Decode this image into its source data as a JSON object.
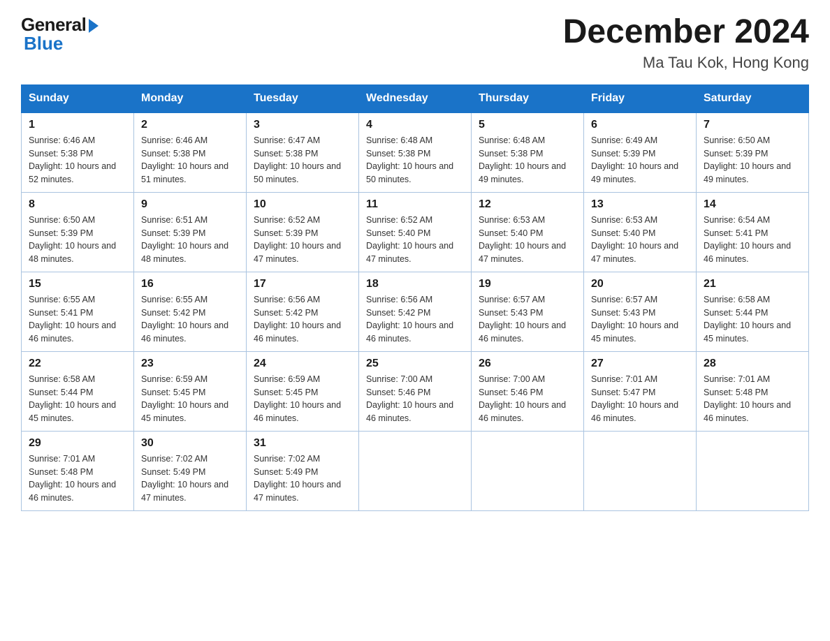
{
  "logo": {
    "general": "General",
    "blue": "Blue"
  },
  "title": "December 2024",
  "location": "Ma Tau Kok, Hong Kong",
  "headers": [
    "Sunday",
    "Monday",
    "Tuesday",
    "Wednesday",
    "Thursday",
    "Friday",
    "Saturday"
  ],
  "weeks": [
    [
      {
        "day": "1",
        "sunrise": "6:46 AM",
        "sunset": "5:38 PM",
        "daylight": "10 hours and 52 minutes."
      },
      {
        "day": "2",
        "sunrise": "6:46 AM",
        "sunset": "5:38 PM",
        "daylight": "10 hours and 51 minutes."
      },
      {
        "day": "3",
        "sunrise": "6:47 AM",
        "sunset": "5:38 PM",
        "daylight": "10 hours and 50 minutes."
      },
      {
        "day": "4",
        "sunrise": "6:48 AM",
        "sunset": "5:38 PM",
        "daylight": "10 hours and 50 minutes."
      },
      {
        "day": "5",
        "sunrise": "6:48 AM",
        "sunset": "5:38 PM",
        "daylight": "10 hours and 49 minutes."
      },
      {
        "day": "6",
        "sunrise": "6:49 AM",
        "sunset": "5:39 PM",
        "daylight": "10 hours and 49 minutes."
      },
      {
        "day": "7",
        "sunrise": "6:50 AM",
        "sunset": "5:39 PM",
        "daylight": "10 hours and 49 minutes."
      }
    ],
    [
      {
        "day": "8",
        "sunrise": "6:50 AM",
        "sunset": "5:39 PM",
        "daylight": "10 hours and 48 minutes."
      },
      {
        "day": "9",
        "sunrise": "6:51 AM",
        "sunset": "5:39 PM",
        "daylight": "10 hours and 48 minutes."
      },
      {
        "day": "10",
        "sunrise": "6:52 AM",
        "sunset": "5:39 PM",
        "daylight": "10 hours and 47 minutes."
      },
      {
        "day": "11",
        "sunrise": "6:52 AM",
        "sunset": "5:40 PM",
        "daylight": "10 hours and 47 minutes."
      },
      {
        "day": "12",
        "sunrise": "6:53 AM",
        "sunset": "5:40 PM",
        "daylight": "10 hours and 47 minutes."
      },
      {
        "day": "13",
        "sunrise": "6:53 AM",
        "sunset": "5:40 PM",
        "daylight": "10 hours and 47 minutes."
      },
      {
        "day": "14",
        "sunrise": "6:54 AM",
        "sunset": "5:41 PM",
        "daylight": "10 hours and 46 minutes."
      }
    ],
    [
      {
        "day": "15",
        "sunrise": "6:55 AM",
        "sunset": "5:41 PM",
        "daylight": "10 hours and 46 minutes."
      },
      {
        "day": "16",
        "sunrise": "6:55 AM",
        "sunset": "5:42 PM",
        "daylight": "10 hours and 46 minutes."
      },
      {
        "day": "17",
        "sunrise": "6:56 AM",
        "sunset": "5:42 PM",
        "daylight": "10 hours and 46 minutes."
      },
      {
        "day": "18",
        "sunrise": "6:56 AM",
        "sunset": "5:42 PM",
        "daylight": "10 hours and 46 minutes."
      },
      {
        "day": "19",
        "sunrise": "6:57 AM",
        "sunset": "5:43 PM",
        "daylight": "10 hours and 46 minutes."
      },
      {
        "day": "20",
        "sunrise": "6:57 AM",
        "sunset": "5:43 PM",
        "daylight": "10 hours and 45 minutes."
      },
      {
        "day": "21",
        "sunrise": "6:58 AM",
        "sunset": "5:44 PM",
        "daylight": "10 hours and 45 minutes."
      }
    ],
    [
      {
        "day": "22",
        "sunrise": "6:58 AM",
        "sunset": "5:44 PM",
        "daylight": "10 hours and 45 minutes."
      },
      {
        "day": "23",
        "sunrise": "6:59 AM",
        "sunset": "5:45 PM",
        "daylight": "10 hours and 45 minutes."
      },
      {
        "day": "24",
        "sunrise": "6:59 AM",
        "sunset": "5:45 PM",
        "daylight": "10 hours and 46 minutes."
      },
      {
        "day": "25",
        "sunrise": "7:00 AM",
        "sunset": "5:46 PM",
        "daylight": "10 hours and 46 minutes."
      },
      {
        "day": "26",
        "sunrise": "7:00 AM",
        "sunset": "5:46 PM",
        "daylight": "10 hours and 46 minutes."
      },
      {
        "day": "27",
        "sunrise": "7:01 AM",
        "sunset": "5:47 PM",
        "daylight": "10 hours and 46 minutes."
      },
      {
        "day": "28",
        "sunrise": "7:01 AM",
        "sunset": "5:48 PM",
        "daylight": "10 hours and 46 minutes."
      }
    ],
    [
      {
        "day": "29",
        "sunrise": "7:01 AM",
        "sunset": "5:48 PM",
        "daylight": "10 hours and 46 minutes."
      },
      {
        "day": "30",
        "sunrise": "7:02 AM",
        "sunset": "5:49 PM",
        "daylight": "10 hours and 47 minutes."
      },
      {
        "day": "31",
        "sunrise": "7:02 AM",
        "sunset": "5:49 PM",
        "daylight": "10 hours and 47 minutes."
      },
      null,
      null,
      null,
      null
    ]
  ],
  "labels": {
    "sunrise_prefix": "Sunrise: ",
    "sunset_prefix": "Sunset: ",
    "daylight_prefix": "Daylight: "
  }
}
